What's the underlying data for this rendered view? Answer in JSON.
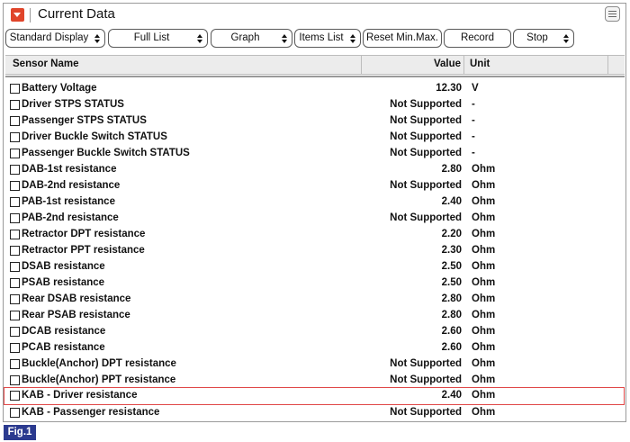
{
  "window": {
    "title": "Current Data"
  },
  "toolbar": {
    "standard_display": "Standard Display",
    "full_list": "Full List",
    "graph": "Graph",
    "items_list": "Items List",
    "reset": "Reset Min.Max.",
    "record": "Record",
    "stop": "Stop"
  },
  "columns": {
    "name": "Sensor Name",
    "value": "Value",
    "unit": "Unit"
  },
  "rows": [
    {
      "name": "Battery Voltage",
      "value": "12.30",
      "unit": "V"
    },
    {
      "name": "Driver STPS STATUS",
      "value": "Not Supported",
      "unit": "-"
    },
    {
      "name": "Passenger STPS STATUS",
      "value": "Not Supported",
      "unit": "-"
    },
    {
      "name": "Driver Buckle Switch STATUS",
      "value": "Not Supported",
      "unit": "-"
    },
    {
      "name": "Passenger Buckle Switch STATUS",
      "value": "Not Supported",
      "unit": "-"
    },
    {
      "name": "DAB-1st resistance",
      "value": "2.80",
      "unit": "Ohm"
    },
    {
      "name": "DAB-2nd resistance",
      "value": "Not Supported",
      "unit": "Ohm"
    },
    {
      "name": "PAB-1st resistance",
      "value": "2.40",
      "unit": "Ohm"
    },
    {
      "name": "PAB-2nd resistance",
      "value": "Not Supported",
      "unit": "Ohm"
    },
    {
      "name": "Retractor DPT resistance",
      "value": "2.20",
      "unit": "Ohm"
    },
    {
      "name": "Retractor PPT resistance",
      "value": "2.30",
      "unit": "Ohm"
    },
    {
      "name": "DSAB resistance",
      "value": "2.50",
      "unit": "Ohm"
    },
    {
      "name": "PSAB resistance",
      "value": "2.50",
      "unit": "Ohm"
    },
    {
      "name": "Rear DSAB resistance",
      "value": "2.80",
      "unit": "Ohm"
    },
    {
      "name": "Rear PSAB resistance",
      "value": "2.80",
      "unit": "Ohm"
    },
    {
      "name": "DCAB resistance",
      "value": "2.60",
      "unit": "Ohm"
    },
    {
      "name": "PCAB resistance",
      "value": "2.60",
      "unit": "Ohm"
    },
    {
      "name": "Buckle(Anchor) DPT resistance",
      "value": "Not Supported",
      "unit": "Ohm"
    },
    {
      "name": "Buckle(Anchor) PPT resistance",
      "value": "Not Supported",
      "unit": "Ohm"
    },
    {
      "name": "KAB - Driver resistance",
      "value": "2.40",
      "unit": "Ohm",
      "highlighted": true
    },
    {
      "name": "KAB - Passenger resistance",
      "value": "Not Supported",
      "unit": "Ohm"
    }
  ],
  "figure_label": "Fig.1",
  "colors": {
    "title_icon": "#e0452b",
    "highlight_border": "#e04848",
    "figure_badge": "#2b3a8f"
  }
}
